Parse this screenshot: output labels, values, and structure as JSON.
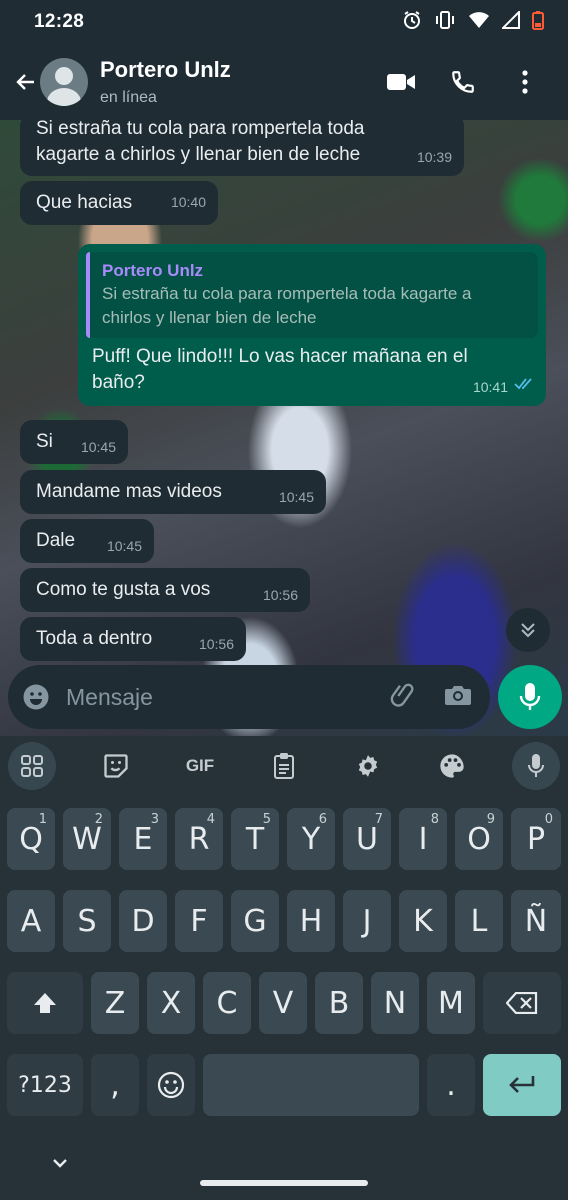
{
  "status_bar": {
    "time": "12:28"
  },
  "header": {
    "name": "Portero Unlz",
    "status": "en línea"
  },
  "messages": [
    {
      "dir": "in",
      "lines": [
        "Si estraña tu cola para rompertela toda",
        "kagarte a chirlos y llenar bien de leche"
      ],
      "time": "10:39"
    },
    {
      "dir": "in",
      "text": "Que hacias",
      "time": "10:40"
    },
    {
      "dir": "out",
      "quote_name": "Portero Unlz",
      "quote_lines": [
        "Si estraña tu cola para rompertela toda kagarte a",
        "chirlos y llenar bien de leche"
      ],
      "lines": [
        "Puff! Que lindo!!! Lo vas hacer mañana en el",
        "baño?"
      ],
      "time": "10:41"
    },
    {
      "dir": "in",
      "text": "Si",
      "time": "10:45"
    },
    {
      "dir": "in",
      "text": "Mandame mas videos",
      "time": "10:45"
    },
    {
      "dir": "in",
      "text": "Dale",
      "time": "10:45"
    },
    {
      "dir": "in",
      "text": "Como te gusta a vos",
      "time": "10:56"
    },
    {
      "dir": "in",
      "text": "Toda a dentro",
      "time": "10:56"
    }
  ],
  "composer": {
    "placeholder": "Mensaje"
  },
  "keyboard": {
    "toolbar_gif": "GIF",
    "row1": [
      {
        "k": "Q",
        "h": "1"
      },
      {
        "k": "W",
        "h": "2"
      },
      {
        "k": "E",
        "h": "3"
      },
      {
        "k": "R",
        "h": "4"
      },
      {
        "k": "T",
        "h": "5"
      },
      {
        "k": "Y",
        "h": "6"
      },
      {
        "k": "U",
        "h": "7"
      },
      {
        "k": "I",
        "h": "8"
      },
      {
        "k": "O",
        "h": "9"
      },
      {
        "k": "P",
        "h": "0"
      }
    ],
    "row2": [
      "A",
      "S",
      "D",
      "F",
      "G",
      "H",
      "J",
      "K",
      "L",
      "Ñ"
    ],
    "row3": [
      "Z",
      "X",
      "C",
      "V",
      "B",
      "N",
      "M"
    ],
    "sym_label": "?123",
    "comma": ",",
    "period": "."
  },
  "colors": {
    "incoming": "#1f2c34",
    "outgoing": "#005c4b",
    "accent": "#00a884",
    "quote_name": "#a78bfa"
  }
}
